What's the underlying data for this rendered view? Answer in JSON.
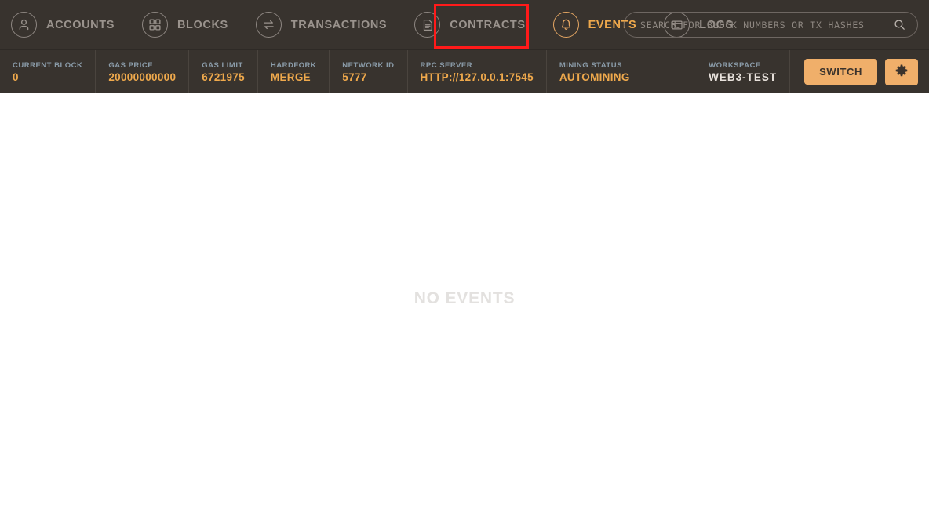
{
  "nav": {
    "tabs": [
      {
        "id": "accounts",
        "label": "ACCOUNTS",
        "icon": "person-icon",
        "active": false
      },
      {
        "id": "blocks",
        "label": "BLOCKS",
        "icon": "grid-blocks-icon",
        "active": false
      },
      {
        "id": "transactions",
        "label": "TRANSACTIONS",
        "icon": "swap-arrows-icon",
        "active": false
      },
      {
        "id": "contracts",
        "label": "CONTRACTS",
        "icon": "document-icon",
        "active": false
      },
      {
        "id": "events",
        "label": "EVENTS",
        "icon": "bell-icon",
        "active": true
      },
      {
        "id": "logs",
        "label": "LOGS",
        "icon": "terminal-icon",
        "active": false
      }
    ],
    "active_tab": "EVENTS",
    "highlight_color": "#FF1A1A"
  },
  "search": {
    "placeholder": "SEARCH FOR BLOCK NUMBERS OR TX HASHES",
    "value": "",
    "icon": "search-icon"
  },
  "status": {
    "items": [
      {
        "label": "CURRENT BLOCK",
        "value": "0"
      },
      {
        "label": "GAS PRICE",
        "value": "20000000000"
      },
      {
        "label": "GAS LIMIT",
        "value": "6721975"
      },
      {
        "label": "HARDFORK",
        "value": "MERGE"
      },
      {
        "label": "NETWORK ID",
        "value": "5777"
      },
      {
        "label": "RPC SERVER",
        "value": "HTTP://127.0.0.1:7545"
      },
      {
        "label": "MINING STATUS",
        "value": "AUTOMINING"
      }
    ],
    "workspace": {
      "label": "WORKSPACE",
      "value": "WEB3-TEST"
    }
  },
  "actions": {
    "switch_label": "SWITCH",
    "settings_icon": "gear-icon"
  },
  "main": {
    "empty_message": "NO EVENTS"
  },
  "colors": {
    "bar_background": "#38332E",
    "accent_orange": "#EFA94C",
    "button_orange": "#F0AF6A",
    "label_blue": "#8A9BA8",
    "inactive_text": "#9A938D",
    "content_background": "#FFFFFF",
    "empty_text": "#E3E1DF"
  }
}
